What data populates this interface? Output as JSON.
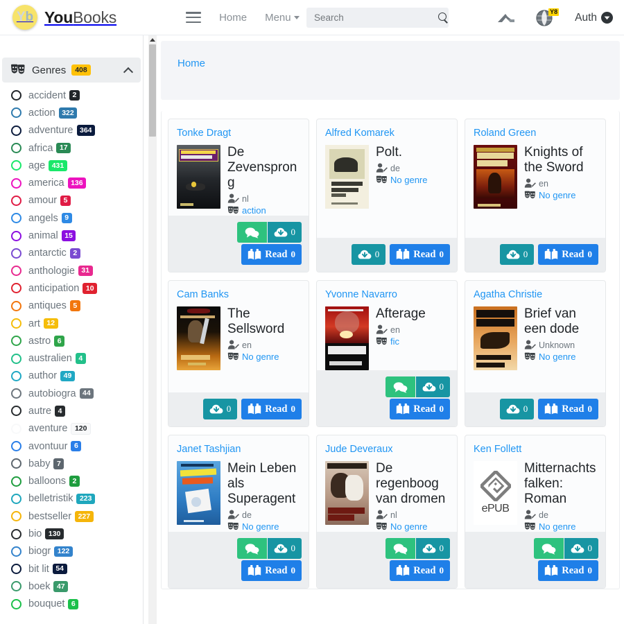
{
  "navbar": {
    "brand": {
      "logo_y": "Y",
      "logo_b": "b",
      "name_bold": "You",
      "name_light": "Books"
    },
    "menu_icon": "hamburger-icon",
    "links": [
      {
        "label": "Home",
        "has_caret": false
      },
      {
        "label": "Menu",
        "has_caret": true
      }
    ],
    "search": {
      "placeholder": "Search",
      "value": ""
    },
    "lang_badge": "Y8",
    "auth_label": "Auth"
  },
  "sidebar": {
    "header": {
      "title": "Genres",
      "count": "408",
      "collapse_state": "expanded"
    },
    "genres": [
      {
        "label": "accident",
        "count": "2",
        "color": "#212529"
      },
      {
        "label": "action",
        "count": "322",
        "color": "#2e7aad"
      },
      {
        "label": "adventure",
        "count": "364",
        "color": "#0b1b3d"
      },
      {
        "label": "africa",
        "count": "17",
        "color": "#2a8a55"
      },
      {
        "label": "age",
        "count": "431",
        "color": "#1ae86a"
      },
      {
        "label": "america",
        "count": "136",
        "color": "#ec13be"
      },
      {
        "label": "amour",
        "count": "5",
        "color": "#e01b45"
      },
      {
        "label": "angels",
        "count": "9",
        "color": "#2e8ae5"
      },
      {
        "label": "animal",
        "count": "15",
        "color": "#8c0fe0"
      },
      {
        "label": "antarctic",
        "count": "2",
        "color": "#7a4ad1"
      },
      {
        "label": "anthologie",
        "count": "31",
        "color": "#e8298f"
      },
      {
        "label": "anticipation",
        "count": "10",
        "color": "#e02230"
      },
      {
        "label": "antiques",
        "count": "5",
        "color": "#f2760d"
      },
      {
        "label": "art",
        "count": "12",
        "color": "#f5bd0a"
      },
      {
        "label": "astro",
        "count": "6",
        "color": "#2fa54a"
      },
      {
        "label": "australien",
        "count": "4",
        "color": "#22c08a"
      },
      {
        "label": "author",
        "count": "49",
        "color": "#20a8c4"
      },
      {
        "label": "autobiogra",
        "count": "44",
        "color": "#6c757d"
      },
      {
        "label": "autre",
        "count": "4",
        "color": "#272b2e"
      },
      {
        "label": "aventure",
        "count": "120",
        "color": "#f8f9fa",
        "light": true
      },
      {
        "label": "avontuur",
        "count": "6",
        "color": "#2a7ee8"
      },
      {
        "label": "baby",
        "count": "7",
        "color": "#5d666e"
      },
      {
        "label": "balloons",
        "count": "2",
        "color": "#1f9d3f"
      },
      {
        "label": "belletristik",
        "count": "223",
        "color": "#1fa7bd"
      },
      {
        "label": "bestseller",
        "count": "227",
        "color": "#f5b50a"
      },
      {
        "label": "bio",
        "count": "130",
        "color": "#272b2e"
      },
      {
        "label": "biogr",
        "count": "122",
        "color": "#3383cc"
      },
      {
        "label": "bit lit",
        "count": "54",
        "color": "#0b1b3d"
      },
      {
        "label": "boek",
        "count": "47",
        "color": "#3a9a6b"
      },
      {
        "label": "bouquet",
        "count": "6",
        "color": "#1cc04b"
      }
    ]
  },
  "breadcrumb": {
    "home": "Home"
  },
  "cards": [
    {
      "author": "Tonke Dragt",
      "title": "De Zevensprong",
      "language": "nl",
      "genre": "action",
      "genre_is_link": true,
      "cover_type": "image",
      "cover_style": "dragt",
      "buttons": {
        "comment": true,
        "download_count": "0",
        "read_label": "Read",
        "read_count": "0"
      }
    },
    {
      "author": "Alfred Komarek",
      "title": "Polt.",
      "language": "de",
      "genre": "No genre",
      "genre_is_link": true,
      "cover_type": "image",
      "cover_style": "komarek",
      "buttons": {
        "comment": false,
        "download_count": "0",
        "read_label": "Read",
        "read_count": "0"
      }
    },
    {
      "author": "Roland Green",
      "title": "Knights of the Sword",
      "language": "en",
      "genre": "No genre",
      "genre_is_link": true,
      "cover_type": "image",
      "cover_style": "green",
      "buttons": {
        "comment": false,
        "download_count": "0",
        "read_label": "Read",
        "read_count": "0"
      }
    },
    {
      "author": "Cam Banks",
      "title": "The Sellsword",
      "language": "en",
      "genre": "No genre",
      "genre_is_link": true,
      "cover_type": "image",
      "cover_style": "banks",
      "buttons": {
        "comment": false,
        "download_count": "0",
        "read_label": "Read",
        "read_count": "0"
      }
    },
    {
      "author": "Yvonne Navarro",
      "title": "Afterage",
      "language": "en",
      "genre": "fic",
      "genre_is_link": true,
      "cover_type": "image",
      "cover_style": "navarro",
      "buttons": {
        "comment": true,
        "download_count": "0",
        "read_label": "Read",
        "read_count": "0"
      }
    },
    {
      "author": "Agatha Christie",
      "title": "Brief van een dode",
      "language": "Unknown",
      "genre": "No genre",
      "genre_is_link": true,
      "cover_type": "image",
      "cover_style": "christie",
      "buttons": {
        "comment": false,
        "download_count": "0",
        "read_label": "Read",
        "read_count": "0"
      }
    },
    {
      "author": "Janet Tashjian",
      "title": "Mein Leben als Superagent",
      "language": "de",
      "genre": "No genre",
      "genre_is_link": true,
      "cover_type": "image",
      "cover_style": "tashjian",
      "buttons": {
        "comment": true,
        "download_count": "0",
        "read_label": "Read",
        "read_count": "0"
      }
    },
    {
      "author": "Jude Deveraux",
      "title": "De regenboog van dromen",
      "language": "nl",
      "genre": "No genre",
      "genre_is_link": true,
      "cover_type": "image",
      "cover_style": "deveraux",
      "buttons": {
        "comment": true,
        "download_count": "0",
        "read_label": "Read",
        "read_count": "0"
      }
    },
    {
      "author": "Ken Follett",
      "title": "Mitternachtsfalken: Roman",
      "language": "de",
      "genre": "No genre",
      "genre_is_link": true,
      "cover_type": "epub",
      "cover_label": "ePUB",
      "buttons": {
        "comment": true,
        "download_count": "0",
        "read_label": "Read",
        "read_count": "0"
      }
    }
  ],
  "colors": {
    "accent_blue": "#2196f3",
    "read_button": "#1f7fe8",
    "download_button": "#1795a3",
    "comment_button": "#2ec27e",
    "genres_badge": "#ffc107"
  }
}
